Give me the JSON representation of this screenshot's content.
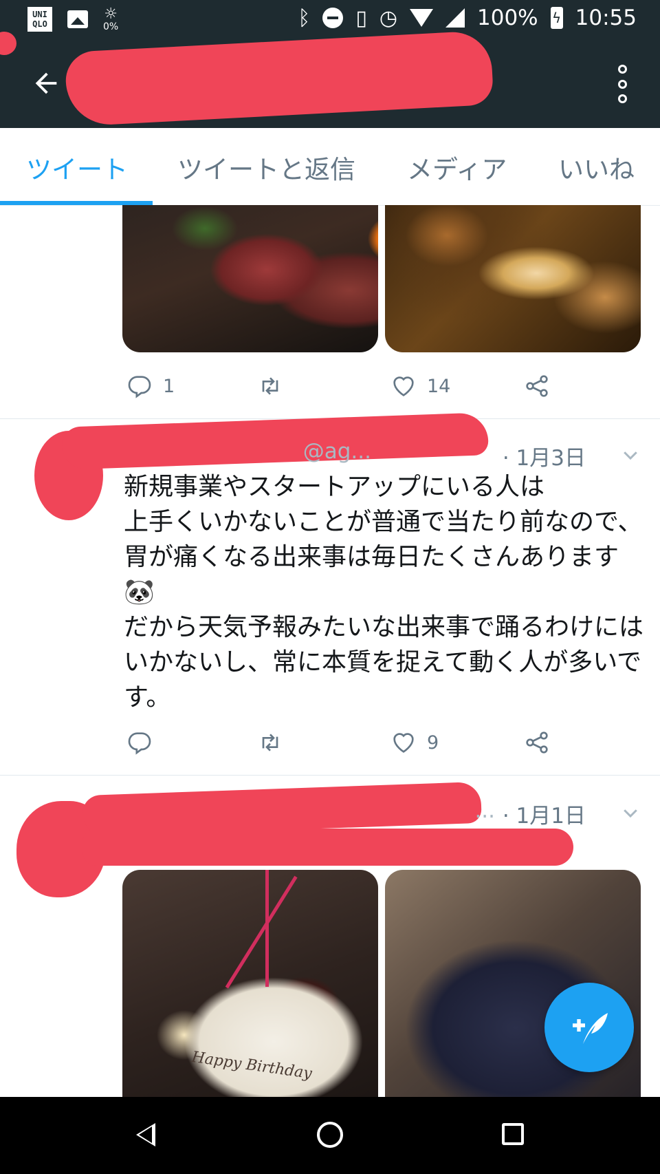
{
  "status_bar": {
    "carrier_logo_top": "UNI",
    "carrier_logo_bottom": "QLO",
    "weather_percent": "0%",
    "battery_percent": "100%",
    "time": "10:55",
    "icons": [
      "uniqlo-icon",
      "image-icon",
      "weather-icon",
      "bluetooth-icon",
      "do-not-disturb-icon",
      "vibrate-icon",
      "alarm-icon",
      "wifi-icon",
      "signal-icon",
      "battery-charging-icon"
    ]
  },
  "app_bar": {
    "back_icon": "arrow-left-icon",
    "more_icon": "more-vertical-icon"
  },
  "tabs": [
    {
      "label": "ツイート",
      "active": true
    },
    {
      "label": "ツイートと返信",
      "active": false
    },
    {
      "label": "メディア",
      "active": false
    },
    {
      "label": "いいね",
      "active": false
    }
  ],
  "tweets": [
    {
      "replies": "1",
      "retweets": "",
      "likes": "14"
    },
    {
      "date": "· 1月3日",
      "handle_fragment": "@ag...",
      "text": "新規事業やスタートアップにいる人は\n上手くいかないことが普通で当たり前なので、胃が痛くなる出来事は毎日たくさんあります🐼\nだから天気予報みたいな出来事で踊るわけにはいかないし、常に本質を捉えて動く人が多いです。",
      "replies": "",
      "retweets": "",
      "likes": "9"
    },
    {
      "date": "· 1月1日",
      "handle_fragment": "...",
      "media_caption": "Happy Birthday"
    }
  ],
  "fab": {
    "icon": "compose-tweet-icon"
  },
  "colors": {
    "app_bar": "#1e2b30",
    "accent": "#1da1f2",
    "secondary_text": "#657786",
    "redaction": "#f04558"
  }
}
